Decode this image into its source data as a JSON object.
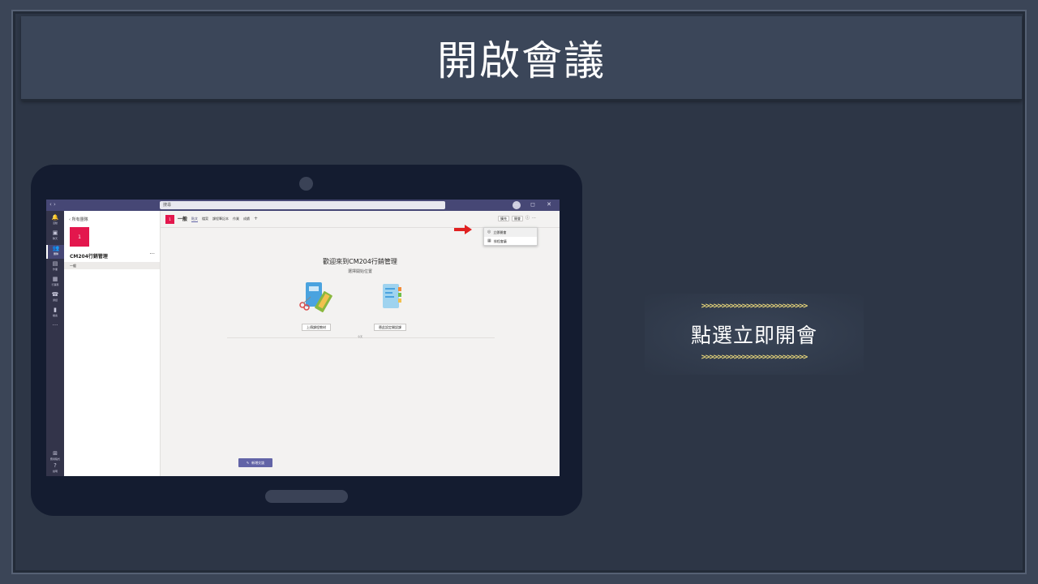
{
  "slide": {
    "title": "開啟會議"
  },
  "teams": {
    "search_placeholder": "搜尋",
    "nav_arrows": "‹ ›",
    "window_controls": "— ◻ ✕",
    "rail": [
      {
        "icon": "bell-icon",
        "glyph": "🔔",
        "label": "活動"
      },
      {
        "icon": "chat-icon",
        "glyph": "▣",
        "label": "聊天"
      },
      {
        "icon": "teams-icon",
        "glyph": "👥",
        "label": "團隊"
      },
      {
        "icon": "assignments-icon",
        "glyph": "▤",
        "label": "作業"
      },
      {
        "icon": "calendar-icon",
        "glyph": "▦",
        "label": "行事曆"
      },
      {
        "icon": "phone-icon",
        "glyph": "☎",
        "label": "通話"
      },
      {
        "icon": "files-icon",
        "glyph": "▮",
        "label": "檔案"
      },
      {
        "icon": "more-icon",
        "glyph": "···",
        "label": ""
      }
    ],
    "rail_bottom": [
      {
        "icon": "apps-icon",
        "glyph": "⊞",
        "label": "應用程式"
      },
      {
        "icon": "help-icon",
        "glyph": "?",
        "label": "說明"
      }
    ],
    "channel_list": {
      "back_label": "‹  所有團隊",
      "team_tile": "1",
      "team_name": "CM204行銷管理",
      "more": "···",
      "general_channel": "一般"
    },
    "channel_header": {
      "tile": "1",
      "title": "一般",
      "tabs": [
        "貼文",
        "檔案",
        "課程筆記本",
        "作業",
        "成績"
      ],
      "add_tab": "+",
      "actions": {
        "expand": "擴充",
        "meet": "開會",
        "info_icon": "ⓘ",
        "more": "···"
      }
    },
    "meet_menu": {
      "items": [
        {
          "icon": "camera-icon",
          "glyph": "◎",
          "label": "立即開會"
        },
        {
          "icon": "calendar-icon",
          "glyph": "▦",
          "label": "排程會議"
        }
      ]
    },
    "welcome": {
      "title": "歡迎來到CM204行銷管理",
      "subtitle": "選擇開始位置"
    },
    "cards": [
      {
        "label": "上傳課程教材"
      },
      {
        "label": "替此設定開設課"
      }
    ],
    "today_label": "今天",
    "new_conversation": "新增交談"
  },
  "callout": {
    "chevrons": ">>>>>>>>>>>>>>>>>>>>>>>>>>",
    "text": "點選立即開會"
  },
  "colors": {
    "accent": "#6264a7",
    "team_tile": "#e3174d",
    "rail": "#33344a",
    "titlebar": "#464775",
    "chevron": "#e8d67a",
    "arrow": "#e02020"
  }
}
